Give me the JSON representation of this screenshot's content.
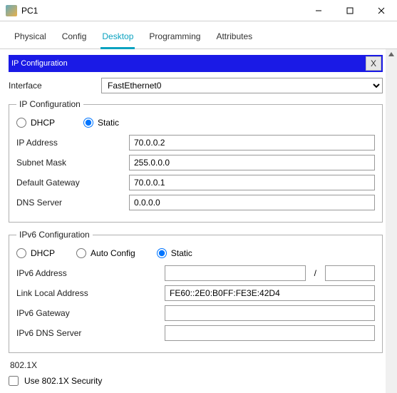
{
  "window": {
    "title": "PC1"
  },
  "tabs": {
    "items": [
      "Physical",
      "Config",
      "Desktop",
      "Programming",
      "Attributes"
    ],
    "active": 2
  },
  "panel": {
    "title": "IP Configuration",
    "close": "X"
  },
  "interface": {
    "label": "Interface",
    "value": "FastEthernet0"
  },
  "ipv4": {
    "legend": "IP Configuration",
    "dhcp": "DHCP",
    "static": "Static",
    "fields": {
      "ip": {
        "label": "IP Address",
        "value": "70.0.0.2"
      },
      "mask": {
        "label": "Subnet Mask",
        "value": "255.0.0.0"
      },
      "gw": {
        "label": "Default Gateway",
        "value": "70.0.0.1"
      },
      "dns": {
        "label": "DNS Server",
        "value": "0.0.0.0"
      }
    }
  },
  "ipv6": {
    "legend": "IPv6 Configuration",
    "dhcp": "DHCP",
    "auto": "Auto Config",
    "static": "Static",
    "fields": {
      "addr": {
        "label": "IPv6 Address",
        "value": "",
        "prefix": ""
      },
      "ll": {
        "label": "Link Local Address",
        "value": "FE60::2E0:B0FF:FE3E:42D4"
      },
      "gw": {
        "label": "IPv6 Gateway",
        "value": ""
      },
      "dns": {
        "label": "IPv6 DNS Server",
        "value": ""
      }
    }
  },
  "dot1x": {
    "legend": "802.1X",
    "use": "Use 802.1X Security"
  }
}
